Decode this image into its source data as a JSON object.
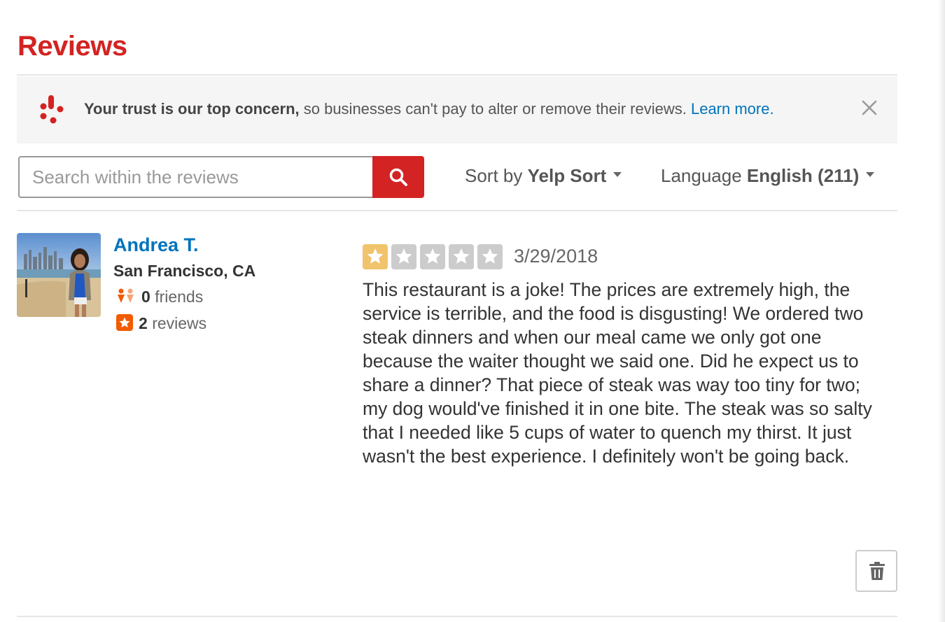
{
  "page": {
    "title": "Reviews"
  },
  "trust_banner": {
    "bold_text": "Your trust is our top concern,",
    "text": " so businesses can't pay to alter or remove their reviews. ",
    "link_text": "Learn more.",
    "logo_icon": "yelp-burst-icon",
    "close_icon": "close-icon"
  },
  "search": {
    "placeholder": "Search within the reviews",
    "value": "",
    "button_icon": "search-icon"
  },
  "sort": {
    "label": "Sort by",
    "value": "Yelp Sort"
  },
  "language": {
    "label": "Language",
    "value": "English (211)"
  },
  "review": {
    "user": {
      "name": "Andrea T.",
      "location": "San Francisco, CA",
      "friends_count": "0",
      "friends_label": "friends",
      "reviews_count": "2",
      "reviews_label": "reviews"
    },
    "rating": 1,
    "rating_max": 5,
    "date": "3/29/2018",
    "text": "This restaurant is a joke! The prices are extremely high, the service is terrible, and the food is disgusting! We ordered two steak dinners and when our meal came we only got one because the waiter thought we said one. Did he expect us to share a dinner? That piece of steak was way too tiny for two; my dog would've finished it in one bite. The steak was so salty that I needed like 5 cups of water to quench my thirst. It just wasn't the best experience. I definitely won't be going back."
  },
  "colors": {
    "brand_red": "#d32323",
    "link_blue": "#0073bb",
    "star_filled": "#f0c36c",
    "star_empty": "#cccccc"
  }
}
